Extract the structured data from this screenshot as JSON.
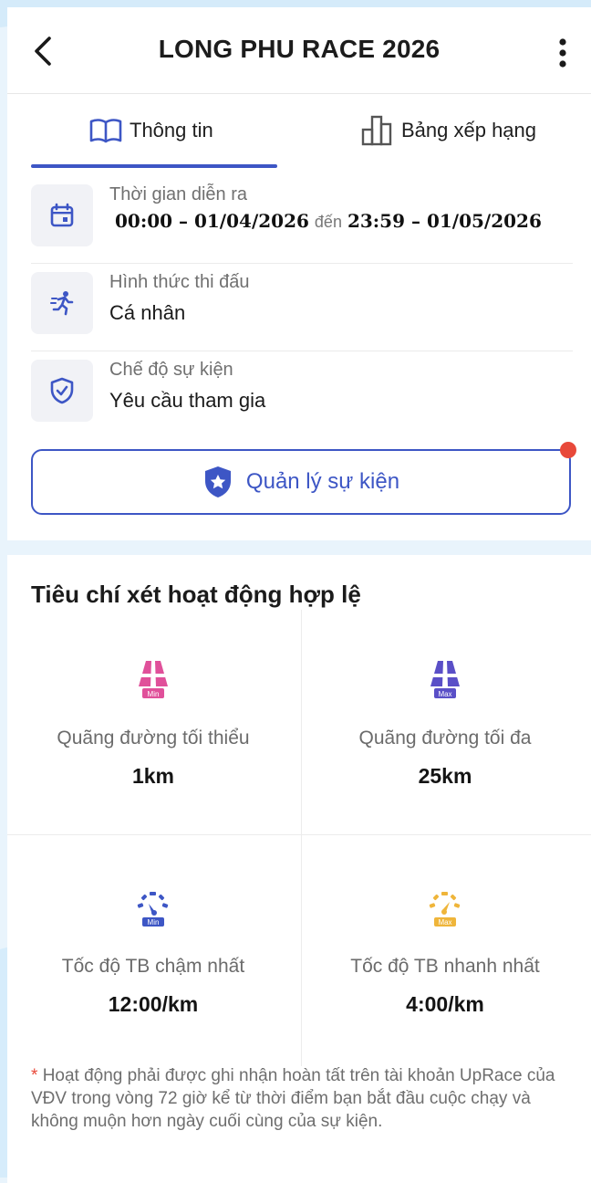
{
  "header": {
    "title": "LONG PHU RACE 2026"
  },
  "tabs": [
    {
      "label": "Thông tin",
      "icon": "book-icon",
      "active": true
    },
    {
      "label": "Bảng xếp hạng",
      "icon": "bar-chart-icon",
      "active": false
    }
  ],
  "info": {
    "time": {
      "label": "Thời gian diễn ra",
      "start": "00:00 – 01/04/2026",
      "separator": "đến",
      "end": "23:59 – 01/05/2026",
      "icon": "calendar-icon"
    },
    "format": {
      "label": "Hình thức thi đấu",
      "value": "Cá nhân",
      "icon": "runner-icon"
    },
    "mode": {
      "label": "Chế độ sự kiện",
      "value": "Yêu cầu tham gia",
      "icon": "shield-check-icon"
    }
  },
  "manage_button": {
    "label": "Quản lý sự kiện",
    "icon": "shield-star-icon"
  },
  "criteria": {
    "title": "Tiêu chí xét hoạt động hợp lệ",
    "items": [
      {
        "label": "Quãng đường tối thiểu",
        "value": "1km",
        "badge": "Min",
        "icon": "road-min-icon"
      },
      {
        "label": "Quãng đường tối đa",
        "value": "25km",
        "badge": "Max",
        "icon": "road-max-icon"
      },
      {
        "label": "Tốc độ TB chậm nhất",
        "value": "12:00/km",
        "badge": "Min",
        "icon": "speedometer-min-icon"
      },
      {
        "label": "Tốc độ TB nhanh nhất",
        "value": "4:00/km",
        "badge": "Max",
        "icon": "speedometer-max-icon"
      }
    ],
    "note_star": "*",
    "note": "Hoạt động phải được ghi nhận hoàn tất trên tài khoản UpRace của VĐV trong vòng 72 giờ kể từ thời điểm bạn bắt đầu cuộc chạy và không muộn hơn ngày cuối cùng của sự kiện."
  },
  "colors": {
    "accent": "#3d56c5",
    "dot": "#e8493a",
    "min_pink": "#e0509a",
    "max_purple": "#5a4fc7",
    "speed_min": "#3d56c5",
    "speed_max": "#efb53a"
  }
}
